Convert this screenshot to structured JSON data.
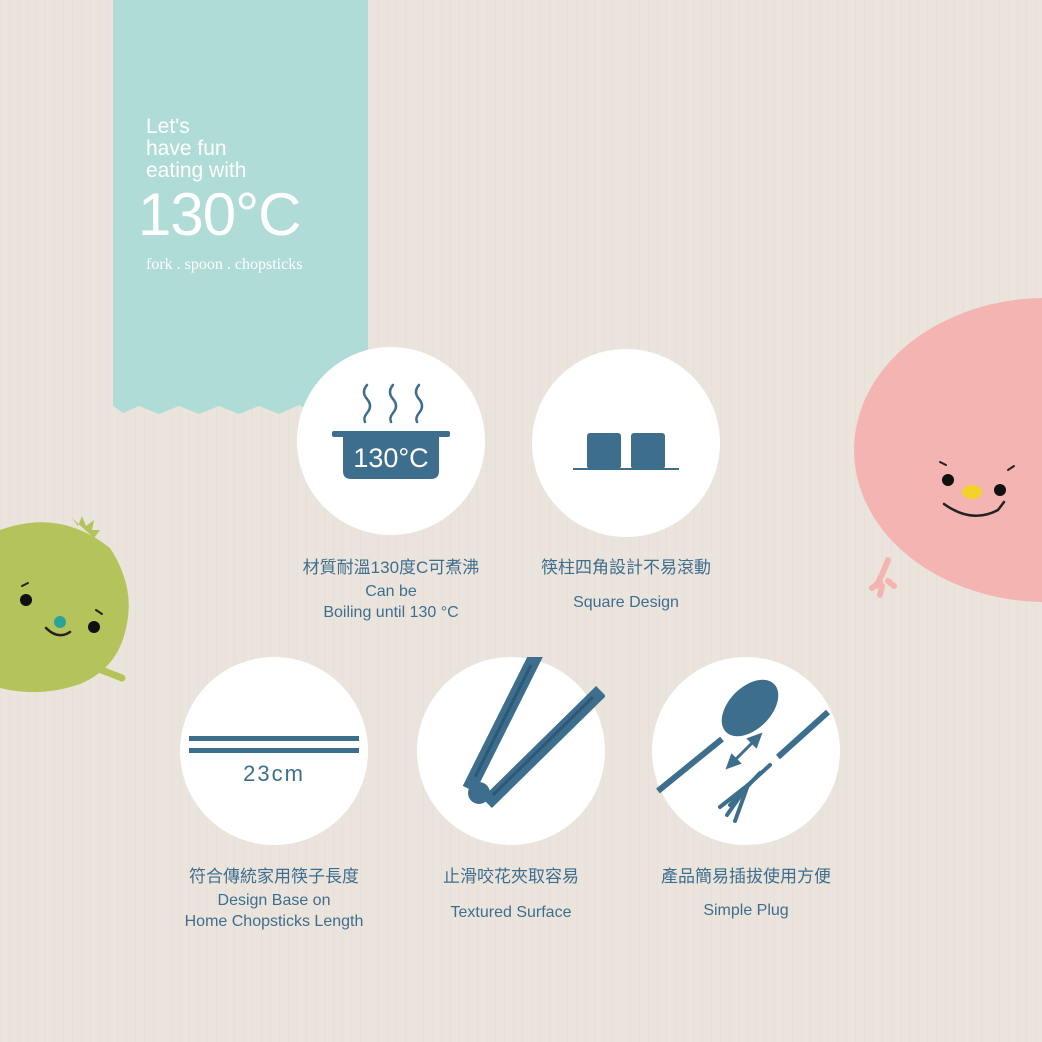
{
  "colors": {
    "background": "#ebe4dc",
    "banner": "#b0dcd7",
    "icon_blue": "#3e6e8e",
    "mascot_pink": "#f4b5b2",
    "mascot_green": "#b4c35a"
  },
  "banner": {
    "tagline": [
      "Let's",
      "have fun",
      "eating with"
    ],
    "temperature": "130°C",
    "subtitle": "fork . spoon . chopsticks"
  },
  "features": [
    {
      "icon": "boiling-pot-icon",
      "icon_text": "130°C",
      "zh": "材質耐溫130度C可煮沸",
      "en_lines": [
        "Can be",
        "Boiling until 130 °C"
      ]
    },
    {
      "icon": "square-design-icon",
      "zh": "筷柱四角設計不易滾動",
      "en_lines": [
        "Square Design"
      ]
    },
    {
      "icon": "chopsticks-length-icon",
      "icon_text": "23cm",
      "zh": "符合傳統家用筷子長度",
      "en_lines": [
        "Design Base on",
        "Home Chopsticks Length"
      ]
    },
    {
      "icon": "chopsticks-grip-icon",
      "zh": "止滑咬花夾取容易",
      "en_lines": [
        "Textured Surface"
      ]
    },
    {
      "icon": "spoon-fork-plug-icon",
      "zh": "產品簡易插拔使用方便",
      "en_lines": [
        "Simple Plug"
      ]
    }
  ]
}
